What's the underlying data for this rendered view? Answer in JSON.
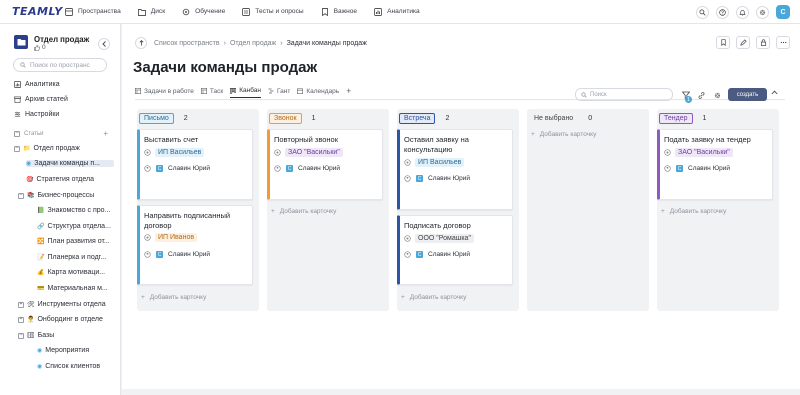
{
  "app": {
    "logo": "TEAMLY"
  },
  "topnav": {
    "items": [
      {
        "label": "Пространства",
        "icon": "spaces-icon"
      },
      {
        "label": "Диск",
        "icon": "folder-icon"
      },
      {
        "label": "Обучение",
        "icon": "gear-icon"
      },
      {
        "label": "Тесты и опросы",
        "icon": "checklist-icon"
      },
      {
        "label": "Важное",
        "icon": "bookmark-icon"
      },
      {
        "label": "Аналитика",
        "icon": "chart-icon"
      }
    ],
    "avatar_letter": "С"
  },
  "sidebar": {
    "space_title": "Отдел продаж",
    "likes": "0",
    "search_placeholder": "Поиск по пространс",
    "links": [
      "Аналитика",
      "Архив статей",
      "Настройки"
    ],
    "section_label": "Статьи",
    "tree": [
      {
        "label": "Отдел продаж"
      },
      {
        "label": "Задачи команды п...",
        "active": true
      },
      {
        "label": "Стратегия отдела"
      },
      {
        "label": "Бизнес-процессы"
      },
      {
        "label": "Знакомство с про..."
      },
      {
        "label": "Структура отдела..."
      },
      {
        "label": "План развития от..."
      },
      {
        "label": "Планерка и подг..."
      },
      {
        "label": "Карта мотиваци..."
      },
      {
        "label": "Материальная м..."
      },
      {
        "label": "Инструменты отдела"
      },
      {
        "label": "Онбординг в отделе"
      },
      {
        "label": "Базы"
      },
      {
        "label": "Мероприятия"
      },
      {
        "label": "Список клиентов"
      }
    ]
  },
  "breadcrumb": {
    "items": [
      "Список пространств",
      "Отдел продаж",
      "Задачи команды продаж"
    ]
  },
  "page": {
    "title": "Задачи команды продаж"
  },
  "tabs": [
    {
      "label": "Задачи в работе"
    },
    {
      "label": "Таск"
    },
    {
      "label": "Канбан",
      "active": true
    },
    {
      "label": "Гант"
    },
    {
      "label": "Календарь"
    }
  ],
  "toolbar": {
    "search_placeholder": "Поиск",
    "filter_count": "1",
    "create_label": "создать"
  },
  "board": {
    "add_card_label": "Добавить карточку",
    "columns": [
      {
        "tag": "Письмо",
        "count": "2",
        "color": "#4ba6d9",
        "bg": "#e3f1fa",
        "cards": [
          {
            "title": "Выставить счет",
            "client": "ИП Васильев",
            "owner": "Славин Юрий"
          },
          {
            "title": "Направить подписанный договор",
            "client": "ИП Иванов",
            "owner": "Славин Юрий"
          }
        ]
      },
      {
        "tag": "Звонок",
        "count": "1",
        "color": "#f29b34",
        "bg": "#fdf0e0",
        "cards": [
          {
            "title": "Повторный звонок",
            "client": "ЗАО \"Васильки\"",
            "owner": "Славин Юрий"
          }
        ]
      },
      {
        "tag": "Встреча",
        "count": "2",
        "color": "#2d55a6",
        "bg": "#e3eaf7",
        "cards": [
          {
            "title": "Оставил заявку на консультацию",
            "client": "ИП Васильев",
            "owner": "Славин Юрий"
          },
          {
            "title": "Подписать договор",
            "client": "ООО \"Ромашка\"",
            "owner": "Славин Юрий"
          }
        ]
      },
      {
        "tag": "Не выбрано",
        "count": "0",
        "color": "#c5c9d0",
        "bg": "#f1f2f4",
        "cards": []
      },
      {
        "tag": "Тендер",
        "count": "1",
        "color": "#8a5cc2",
        "bg": "#efe7f8",
        "cards": [
          {
            "title": "Подать заявку на тендер",
            "client": "ЗАО \"Васильки\"",
            "owner": "Славин Юрий"
          }
        ]
      }
    ]
  }
}
